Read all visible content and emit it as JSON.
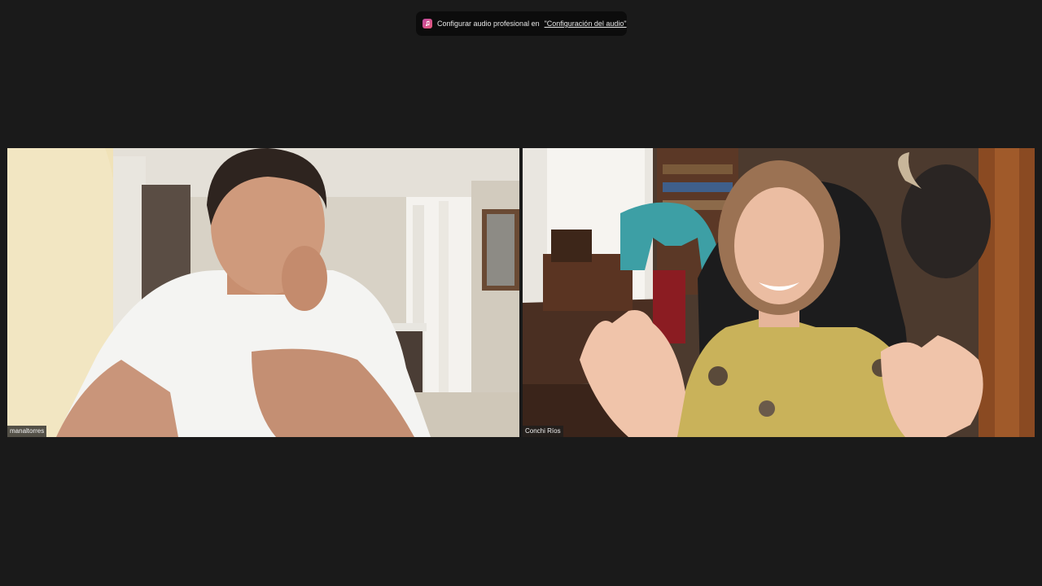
{
  "banner": {
    "icon": "music-note-icon",
    "text": "Configurar audio profesional en",
    "link": "\"Configuración del audio\""
  },
  "participants": [
    {
      "name": "manaltorres"
    },
    {
      "name": "Conchi Ríos"
    }
  ],
  "colors": {
    "background": "#1a1a1a",
    "banner_bg": "#0c0c0c",
    "banner_icon": "#d24f8c"
  }
}
